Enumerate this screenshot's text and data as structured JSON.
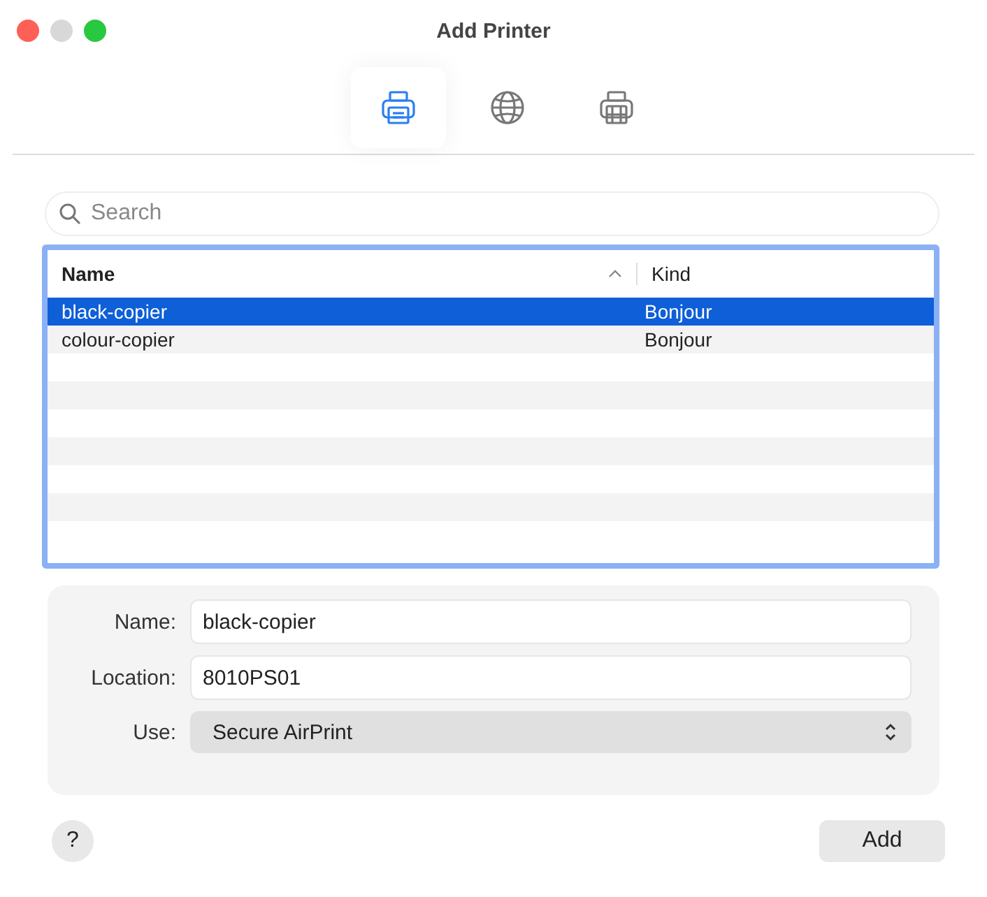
{
  "window": {
    "title": "Add Printer"
  },
  "toolbar": [
    {
      "kind": "printer",
      "selected": true
    },
    {
      "kind": "globe",
      "selected": false
    },
    {
      "kind": "windows",
      "selected": false
    }
  ],
  "search": {
    "placeholder": "Search"
  },
  "table": {
    "columns": [
      {
        "label": "Name",
        "sorted": true
      },
      {
        "label": "Kind",
        "sorted": false
      }
    ],
    "rows": [
      {
        "name": "black-copier",
        "kind": "Bonjour",
        "selected": true
      },
      {
        "name": "colour-copier",
        "kind": "Bonjour",
        "selected": false
      }
    ]
  },
  "form": {
    "name_label": "Name:",
    "name_value": "black-copier",
    "location_label": "Location:",
    "location_value": "8010PS01",
    "use_label": "Use:",
    "use_value": "Secure AirPrint"
  },
  "buttons": {
    "help": "?",
    "add": "Add"
  }
}
